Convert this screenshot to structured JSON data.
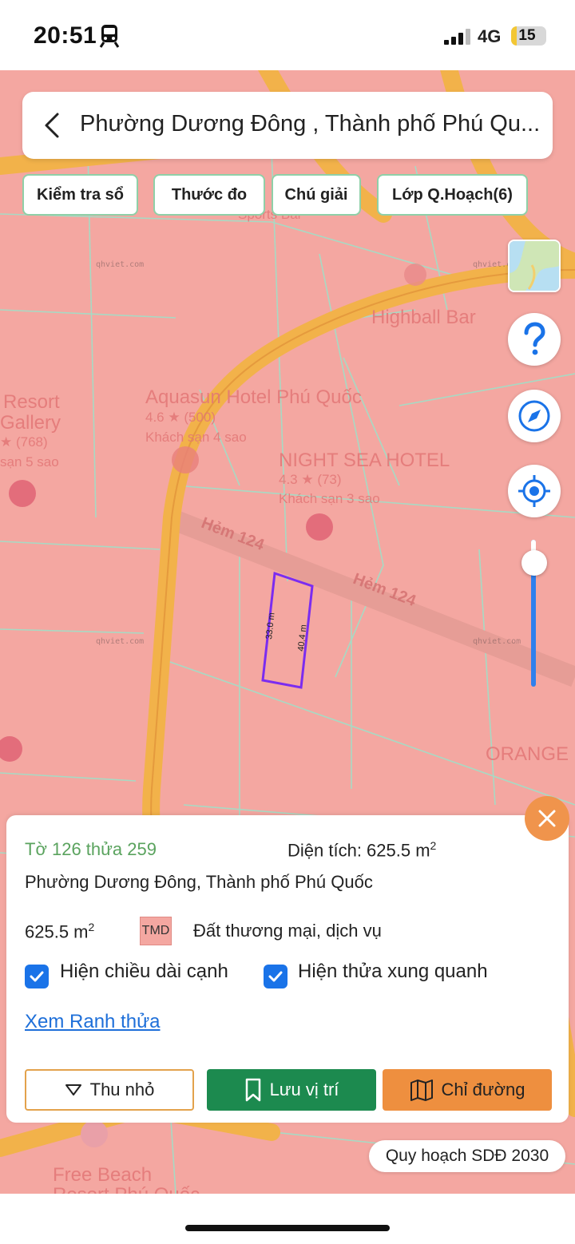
{
  "status_bar": {
    "time": "20:51",
    "network": "4G",
    "battery_level": "15",
    "battery_fraction": 0.15
  },
  "search": {
    "title": "Phường Dương Đông , Thành phố Phú Qu..."
  },
  "chips": [
    {
      "label": "Kiểm tra sổ"
    },
    {
      "label": "Thước đo"
    },
    {
      "label": "Chú giải"
    },
    {
      "label": "Lớp Q.Hoạch(6)"
    }
  ],
  "map": {
    "labels": {
      "place_1": "Highball Bar",
      "place_2": "Aquasun Hotel Phú Quốc",
      "place_2_rating": "4.6 ★ (500)",
      "place_2_type": "Khách sạn 4 sao",
      "place_3": "NIGHT SEA HOTEL",
      "place_3_rating": "4.3 ★ (73)",
      "place_3_type": "Khách sạn 3 sao",
      "place_4_a": "Resort",
      "place_4_b": "Gallery",
      "place_4_rating": "★ (768)",
      "place_4_type": "sạn 5 sao",
      "place_5": "Sports Bar",
      "place_6": "ORANGE",
      "place_7_a": "Free Beach",
      "place_7_b": "Resort Phú Quốc",
      "street_1": "Hẻm 124",
      "street_2": "Hẻm 124",
      "watermark": "qhviet.com"
    },
    "edges": {
      "left_edge": "33.0 m",
      "right_edge": "40.4 m"
    },
    "zoom_level": 0.16,
    "colors": {
      "land": "#f4a7a1",
      "road": "#f2b24a",
      "parcel_line": "#9fe0c8",
      "selected_parcel": "#7b2cf0"
    }
  },
  "panel": {
    "parcel_id": "Tờ 126 thửa 259",
    "area_label": "Diện tích: 625.5 m",
    "area_unit_sup": "2",
    "address": "Phường Dương Đông, Thành phố Phú Quốc",
    "land_area": "625.5 m",
    "land_area_sup": "2",
    "land_code": "TMD",
    "land_type": "Đất thương mại, dịch vụ",
    "checkbox_1": "Hiện chiều dài cạnh",
    "checkbox_2": "Hiện thửa xung quanh",
    "link": "Xem Ranh thửa",
    "btn_collapse": "Thu nhỏ",
    "btn_save": "Lưu vị trí",
    "btn_route": "Chỉ đường"
  },
  "plan_badge": "Quy hoạch SDĐ 2030"
}
